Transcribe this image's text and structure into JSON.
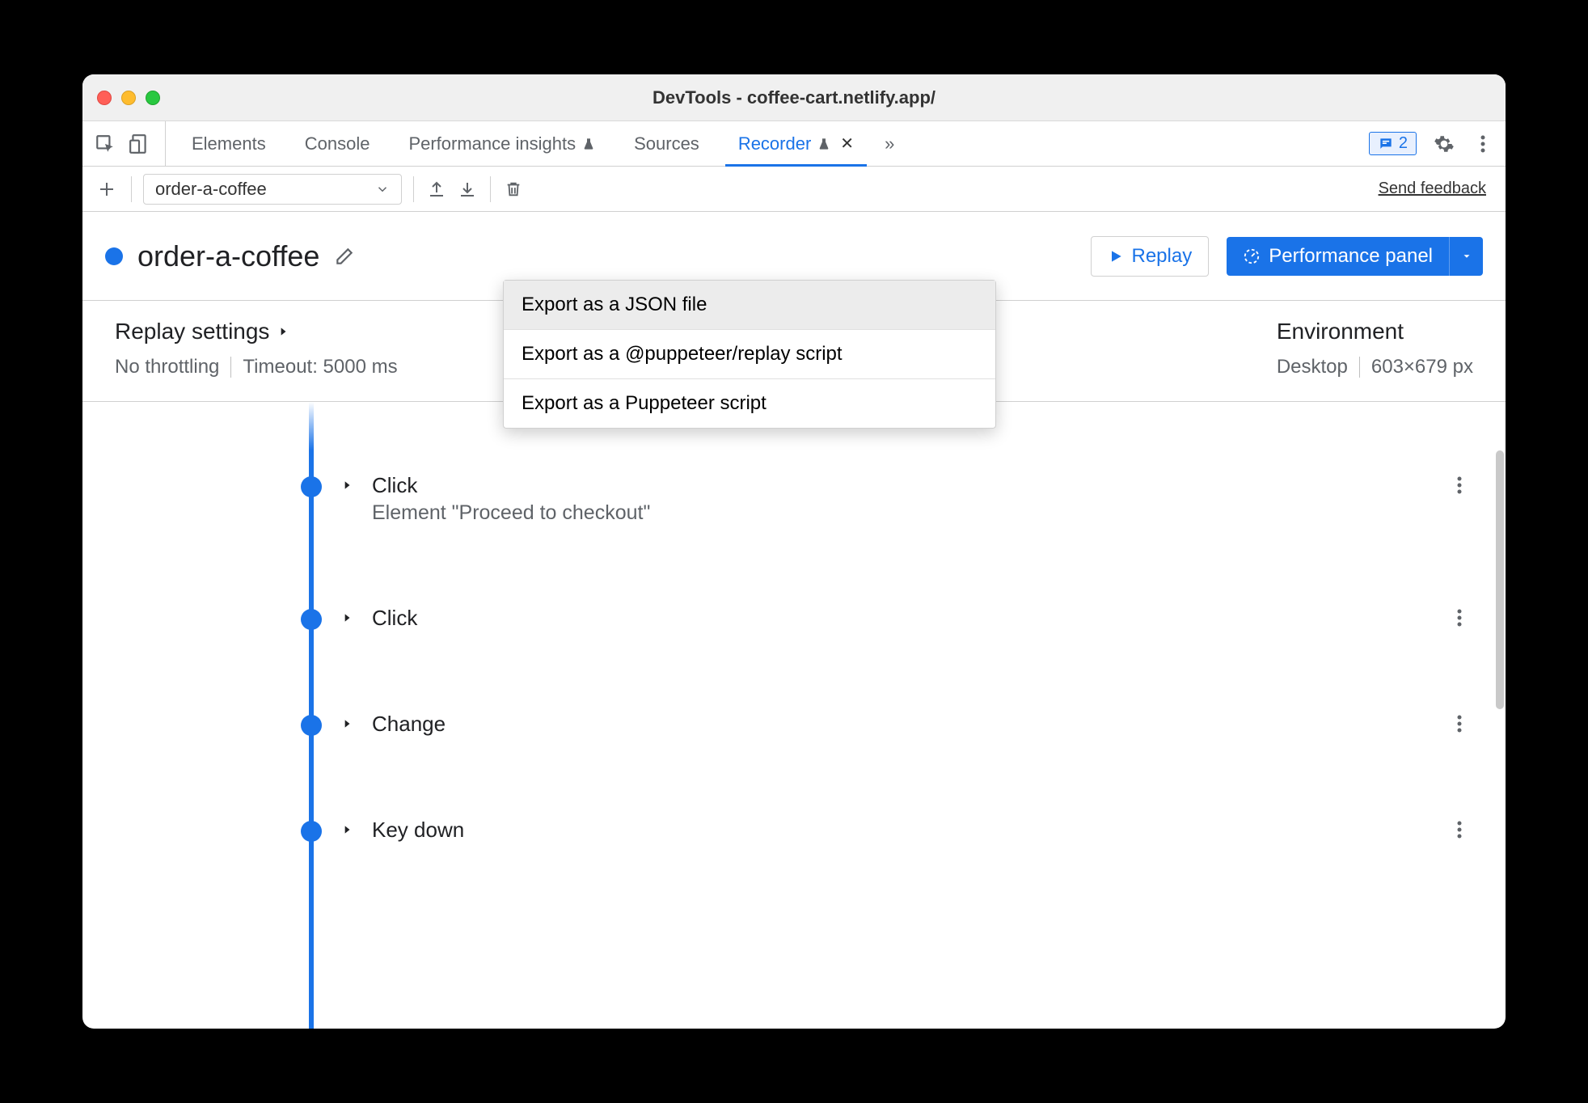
{
  "window": {
    "title": "DevTools - coffee-cart.netlify.app/"
  },
  "tabs": {
    "items": [
      {
        "label": "Elements",
        "active": false,
        "hasFlask": false,
        "closeable": false
      },
      {
        "label": "Console",
        "active": false,
        "hasFlask": false,
        "closeable": false
      },
      {
        "label": "Performance insights",
        "active": false,
        "hasFlask": true,
        "closeable": false
      },
      {
        "label": "Sources",
        "active": false,
        "hasFlask": false,
        "closeable": false
      },
      {
        "label": "Recorder",
        "active": true,
        "hasFlask": true,
        "closeable": true
      }
    ],
    "issues_count": "2"
  },
  "toolbar": {
    "recording_selected": "order-a-coffee",
    "feedback_label": "Send feedback"
  },
  "heading": {
    "name": "order-a-coffee",
    "replay_button": "Replay",
    "perf_button": "Performance panel"
  },
  "export_menu": {
    "items": [
      "Export as a JSON file",
      "Export as a @puppeteer/replay script",
      "Export as a Puppeteer script"
    ]
  },
  "settings": {
    "replay_title": "Replay settings",
    "throttling": "No throttling",
    "timeout": "Timeout: 5000 ms",
    "env_title": "Environment",
    "device": "Desktop",
    "viewport": "603×679 px"
  },
  "steps": [
    {
      "title": "Click",
      "subtitle": "Element \"Proceed to checkout\""
    },
    {
      "title": "Click",
      "subtitle": ""
    },
    {
      "title": "Change",
      "subtitle": ""
    },
    {
      "title": "Key down",
      "subtitle": ""
    }
  ]
}
